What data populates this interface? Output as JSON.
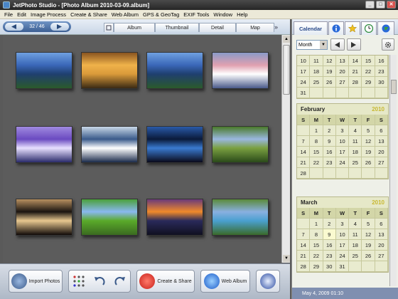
{
  "window": {
    "title": "JetPhoto Studio - [Photo Album 2010-03-09.album]",
    "buttons": [
      "_",
      "□",
      "✕"
    ]
  },
  "menu": [
    "File",
    "Edit",
    "Image Process",
    "Create & Share",
    "Web Album",
    "GPS & GeoTag",
    "EXIF Tools",
    "Window",
    "Help"
  ],
  "nav": {
    "counter": "32 / 46"
  },
  "tabs": [
    "Album",
    "Thumbnail",
    "Detail",
    "Map"
  ],
  "active_tab": "Thumbnail",
  "thumbnails": [
    {
      "name": "lake-island-1",
      "colors": [
        "#3a67b8",
        "#6fa0e0",
        "#1f3f6f",
        "#2b5a2b"
      ]
    },
    {
      "name": "sunset-waves",
      "colors": [
        "#f0b24a",
        "#8a5520",
        "#d99a3a",
        "#3a2a14"
      ]
    },
    {
      "name": "lake-island-2",
      "colors": [
        "#3a67b8",
        "#6fa0e0",
        "#1f3f6f",
        "#2b5a2b"
      ]
    },
    {
      "name": "mountain-dusk",
      "colors": [
        "#e0a0b0",
        "#8a9ac8",
        "#ffffff",
        "#4a5a8a"
      ]
    },
    {
      "name": "purple-mountains",
      "colors": [
        "#6a4ac0",
        "#a08ae0",
        "#e8e0ff",
        "#2a2a6a"
      ]
    },
    {
      "name": "cloud-reflection",
      "colors": [
        "#3a5a8a",
        "#c8d8e8",
        "#ffffff",
        "#1a2a4a"
      ]
    },
    {
      "name": "night-sea",
      "colors": [
        "#0a1a3a",
        "#2a5aa8",
        "#3a7ad0",
        "#0a0a1a"
      ]
    },
    {
      "name": "vineyard-hill",
      "colors": [
        "#9ab8e0",
        "#4a7a2a",
        "#7aa040",
        "#2a4a1a"
      ]
    },
    {
      "name": "autumn-leaf",
      "colors": [
        "#1a1410",
        "#b89060",
        "#e8c890",
        "#100a08"
      ]
    },
    {
      "name": "meadow-tree",
      "colors": [
        "#8ab8f0",
        "#4aa03a",
        "#5aaa2a",
        "#3a6a20"
      ]
    },
    {
      "name": "orange-sunset",
      "colors": [
        "#f08a2a",
        "#6a3a7a",
        "#2a2a5a",
        "#101020"
      ]
    },
    {
      "name": "river-bend",
      "colors": [
        "#8ab0e0",
        "#5a8a3a",
        "#4aa0d0",
        "#3a6a2a"
      ]
    }
  ],
  "toolbar": {
    "import_label": "Import Photos",
    "create_label": "Create & Share",
    "web_label": "Web Album"
  },
  "calendar": {
    "tab_label": "Calendar",
    "view_select": "Month",
    "months": [
      {
        "name": "",
        "year": "",
        "header": false,
        "rows": [
          [
            "10",
            "11",
            "12",
            "13",
            "14",
            "15",
            "16"
          ],
          [
            "17",
            "18",
            "19",
            "20",
            "21",
            "22",
            "23"
          ],
          [
            "24",
            "25",
            "26",
            "27",
            "28",
            "29",
            "30"
          ],
          [
            "31",
            "",
            "",
            "",
            "",
            "",
            ""
          ]
        ]
      },
      {
        "name": "February",
        "year": "2010",
        "header": true,
        "rows": [
          [
            "",
            "1",
            "2",
            "3",
            "4",
            "5",
            "6"
          ],
          [
            "7",
            "8",
            "9",
            "10",
            "11",
            "12",
            "13"
          ],
          [
            "14",
            "15",
            "16",
            "17",
            "18",
            "19",
            "20"
          ],
          [
            "21",
            "22",
            "23",
            "24",
            "25",
            "26",
            "27"
          ],
          [
            "28",
            "",
            "",
            "",
            "",
            "",
            ""
          ]
        ]
      },
      {
        "name": "March",
        "year": "2010",
        "header": true,
        "rows": [
          [
            "",
            "1",
            "2",
            "3",
            "4",
            "5",
            "6"
          ],
          [
            "7",
            "8",
            "9",
            "10",
            "11",
            "12",
            "13"
          ],
          [
            "14",
            "15",
            "16",
            "17",
            "18",
            "19",
            "20"
          ],
          [
            "21",
            "22",
            "23",
            "24",
            "25",
            "26",
            "27"
          ],
          [
            "28",
            "29",
            "30",
            "31",
            "",
            "",
            ""
          ]
        ]
      }
    ],
    "weekdays": [
      "S",
      "M",
      "T",
      "W",
      "T",
      "F",
      "S"
    ],
    "highlight_day": "9"
  },
  "status": {
    "text": "May 4, 2009 01:10"
  }
}
